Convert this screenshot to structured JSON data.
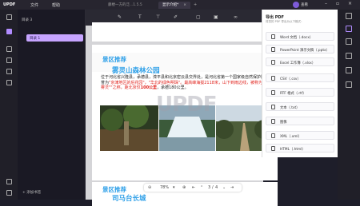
{
  "app": {
    "logo": "UPDF",
    "menu": [
      "文件",
      "帮助"
    ],
    "user": "查看"
  },
  "tabs": [
    {
      "label": "藤楼一方的泛...1.5.5"
    },
    {
      "label": "显示介绍*",
      "active": true
    }
  ],
  "sidebar": {
    "group": "目录 3",
    "item": "目录 1",
    "add_label": "+ 添加书签"
  },
  "toolbar": {
    "icons": [
      "comment-icon",
      "text-icon",
      "edit-icon",
      "image-icon",
      "link-icon",
      "highlight-icon"
    ]
  },
  "doc": {
    "section1_small": "景区推荐",
    "section1_big": "雾灵山森林公园",
    "para_black": "位于河北省兴隆县，承德县，滦平县和北京密云县交界处，是河北省第一个国家级自然保护区，被誉为",
    "para_red": "\"京津地区的后花园\"，\"华北的绿色明珠\"。最高峰海拔2118米，山下到雨边线，被称为\"天下雾灵\"\"之称，距北京仅",
    "para_red2": "100公里",
    "para_tail": "，承德180公里。",
    "watermark": "UPDF",
    "section2_small": "景区推荐",
    "section2_big": "司马台长城"
  },
  "zoom": {
    "value": "78%",
    "page": "3",
    "total": "4"
  },
  "export": {
    "title": "导出 PDF",
    "subtitle": "将您的 PDF 导出为以下格式：",
    "options": [
      "Word 文档（.docx）",
      "PowerPoint 演示文稿（.pptx）",
      "Excel 工作簿（.xlsx）",
      "CSV（.csv）",
      "RTF 格式（.rtf）",
      "文本（.txt）",
      "图像",
      "XML（.xml）",
      "HTML（.html）"
    ]
  }
}
